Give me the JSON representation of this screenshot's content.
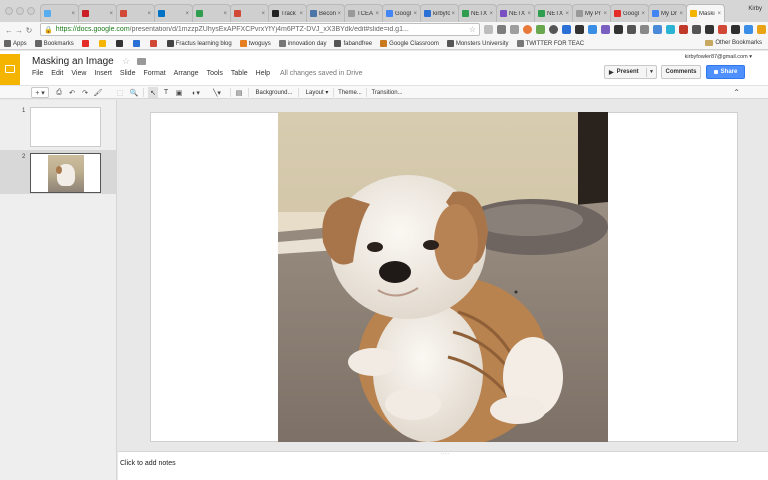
{
  "browser": {
    "tabs": [
      {
        "label": "",
        "favicon": "twitter-icon",
        "color": "#55acee"
      },
      {
        "label": "",
        "favicon": "pinterest-icon",
        "color": "#cb2027"
      },
      {
        "label": "",
        "favicon": "gmail-icon",
        "color": "#d14836"
      },
      {
        "label": "",
        "favicon": "outlook-icon",
        "color": "#0072c6"
      },
      {
        "label": "",
        "favicon": "sheets-icon",
        "color": "#2f9e4f"
      },
      {
        "label": "",
        "favicon": "gmail-icon",
        "color": "#d14836"
      },
      {
        "label": "Track",
        "favicon": "amazon-icon",
        "color": "#222222"
      },
      {
        "label": "Becon",
        "favicon": "link-icon",
        "color": "#4a76a8"
      },
      {
        "label": "TCEA",
        "favicon": "tcea-icon",
        "color": "#999999"
      },
      {
        "label": "Googl",
        "favicon": "google-icon",
        "color": "#4285f4"
      },
      {
        "label": "kirbyfo",
        "favicon": "x-icon",
        "color": "#2a70d6"
      },
      {
        "label": "NETX",
        "favicon": "netx-icon",
        "color": "#2f9e4f"
      },
      {
        "label": "NETX",
        "favicon": "netx-icon",
        "color": "#7b4fc4"
      },
      {
        "label": "NETX",
        "favicon": "netx-icon",
        "color": "#2f9e4f"
      },
      {
        "label": "My Pr",
        "favicon": "doc-icon",
        "color": "#999999"
      },
      {
        "label": "Googl",
        "favicon": "youtube-icon",
        "color": "#e52d27"
      },
      {
        "label": "My Dr",
        "favicon": "drive-icon",
        "color": "#4285f4"
      },
      {
        "label": "Maski",
        "favicon": "slides-icon",
        "color": "#f4b400",
        "active": true
      }
    ],
    "user": "Kirby",
    "url_domain": "https://docs.google.com",
    "url_path": "/presentation/d/1mzzpZUhysExAPFXCPvrxYfYj4m6PTZ-DVJ_xX3BYdk/edit#slide=id.g1..."
  },
  "bookmarks": {
    "items": [
      {
        "label": "Apps",
        "icon": "apps-icon",
        "color": "#666666"
      },
      {
        "label": "Bookmarks",
        "icon": "star-icon",
        "color": "#666666"
      },
      {
        "label": "",
        "icon": "youtube-icon",
        "color": "#e52d27"
      },
      {
        "label": "",
        "icon": "bookmark-icon",
        "color": "#f4b400"
      },
      {
        "label": "",
        "icon": "m-icon",
        "color": "#333333"
      },
      {
        "label": "",
        "icon": "bookmark-icon",
        "color": "#2a70d6"
      },
      {
        "label": "",
        "icon": "bookmark-icon",
        "color": "#d14836"
      },
      {
        "label": "Fractus learning blog",
        "icon": "bookmark-icon",
        "color": "#444444"
      },
      {
        "label": "twoguys",
        "icon": "bookmark-icon",
        "color": "#e67e22"
      },
      {
        "label": "innovation day",
        "icon": "bookmark-icon",
        "color": "#777777"
      },
      {
        "label": "fabandfree",
        "icon": "bookmark-icon",
        "color": "#555555"
      },
      {
        "label": "Google Classroom",
        "icon": "classroom-icon",
        "color": "#c97a1f"
      },
      {
        "label": "Monsters University",
        "icon": "bookmark-icon",
        "color": "#555555"
      },
      {
        "label": "TWITTER FOR TEAC",
        "icon": "bookmark-icon",
        "color": "#777777"
      }
    ],
    "other": "Other Bookmarks"
  },
  "app": {
    "title": "Masking an Image",
    "menus": [
      "File",
      "Edit",
      "View",
      "Insert",
      "Slide",
      "Format",
      "Arrange",
      "Tools",
      "Table",
      "Help"
    ],
    "saved_status": "All changes saved in Drive",
    "account": "kirbyfowler87@gmail.com ▾",
    "present_label": "Present",
    "comments_label": "Comments",
    "share_label": "Share"
  },
  "toolbar": {
    "background": "Background...",
    "layout": "Layout",
    "theme": "Theme...",
    "transition": "Transition..."
  },
  "filmstrip": {
    "slides": [
      {
        "number": "1"
      },
      {
        "number": "2"
      }
    ]
  },
  "notes": {
    "placeholder": "Click to add notes"
  }
}
